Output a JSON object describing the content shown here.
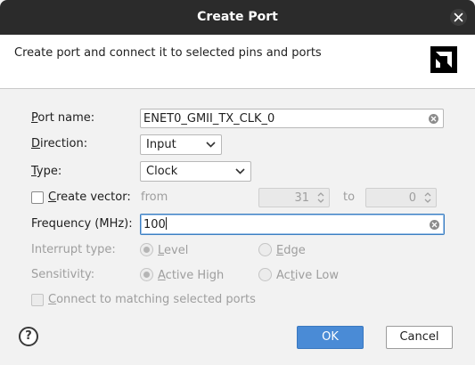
{
  "window": {
    "title": "Create Port"
  },
  "header": {
    "description": "Create port and connect it to selected pins and ports",
    "logo_icon": "amd-logo-icon"
  },
  "form": {
    "port_name": {
      "label_prefix": "P",
      "label_rest": "ort name:",
      "value": "ENET0_GMII_TX_CLK_0"
    },
    "direction": {
      "label_prefix": "D",
      "label_rest": "irection:",
      "value": "Input"
    },
    "type": {
      "label_prefix": "T",
      "label_rest": "ype:",
      "value": "Clock"
    },
    "create_vector": {
      "label_prefix": "C",
      "label_rest": "reate vector:",
      "checked": false,
      "from_label": "from",
      "from_value": "31",
      "to_label": "to",
      "to_value": "0"
    },
    "frequency": {
      "label": "Frequency (MHz):",
      "value": "100"
    },
    "interrupt_type": {
      "label": "Interrupt type:",
      "options": [
        {
          "prefix": "L",
          "rest": "evel",
          "selected": true
        },
        {
          "prefix": "E",
          "rest": "dge",
          "selected": false
        }
      ]
    },
    "sensitivity": {
      "label": "Sensitivity:",
      "options": [
        {
          "prefix": "A",
          "rest": "ctive High",
          "selected": true
        },
        {
          "before": "Ac",
          "prefix": "t",
          "rest": "ive Low",
          "selected": false
        }
      ]
    },
    "connect_matching": {
      "prefix": "C",
      "rest": "onnect to matching selected ports",
      "checked": false
    }
  },
  "footer": {
    "help_label": "?",
    "ok_label": "OK",
    "cancel_label": "Cancel"
  },
  "colors": {
    "titlebar": "#2b2b2b",
    "primary_button": "#4a8bd6",
    "focus_border": "#3d7fc1"
  }
}
